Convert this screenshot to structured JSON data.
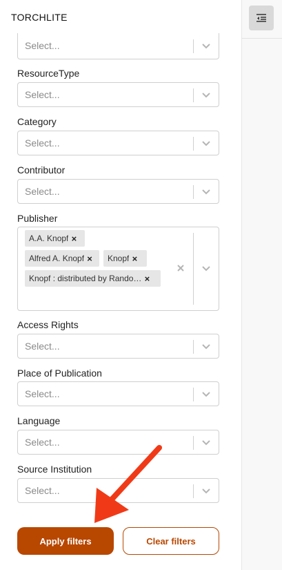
{
  "app": {
    "brand": "TORCHLITE"
  },
  "sidebar_toggle": {
    "icon": "collapse-sidebar-icon"
  },
  "filters": {
    "top_select_placeholder": "Select...",
    "resource_type": {
      "label": "ResourceType",
      "placeholder": "Select..."
    },
    "category": {
      "label": "Category",
      "placeholder": "Select..."
    },
    "contributor": {
      "label": "Contributor",
      "placeholder": "Select..."
    },
    "publisher": {
      "label": "Publisher",
      "tags": [
        "A.A. Knopf",
        "Alfred A. Knopf",
        "Knopf",
        "Knopf : distributed by Rando…"
      ]
    },
    "access_rights": {
      "label": "Access Rights",
      "placeholder": "Select..."
    },
    "place_of_publication": {
      "label": "Place of Publication",
      "placeholder": "Select..."
    },
    "language": {
      "label": "Language",
      "placeholder": "Select..."
    },
    "source_institution": {
      "label": "Source Institution",
      "placeholder": "Select..."
    }
  },
  "actions": {
    "apply": "Apply filters",
    "clear": "Clear filters"
  },
  "colors": {
    "accent": "#b84700",
    "annotation_arrow": "#f03a17"
  }
}
